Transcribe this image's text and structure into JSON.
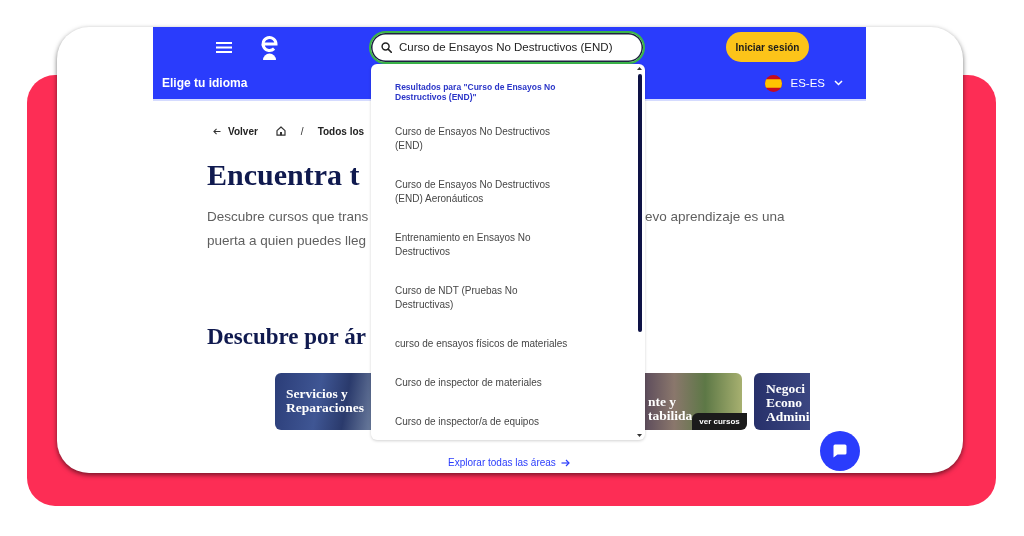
{
  "header": {
    "search": {
      "value": "Curso de Ensayos No Destructivos (END)"
    },
    "login_button": "Iniciar sesión"
  },
  "language_bar": {
    "label": "Elige tu idioma",
    "locale": "ES-ES"
  },
  "search_dropdown": {
    "heading": "Resultados para \"Curso de Ensayos No Destructivos (END)\"",
    "suggestions": [
      "Curso de Ensayos No Destructivos (END)",
      "Curso de Ensayos No Destructivos (END) Aeronáuticos",
      "Entrenamiento en Ensayos No Destructivos",
      "Curso de NDT (Pruebas No Destructivas)",
      "curso de ensayos físicos de materiales",
      "Curso de inspector de materiales",
      "Curso de inspector/a de equipos"
    ]
  },
  "breadcrumb": {
    "back": "Volver",
    "separator": "/",
    "current": "Todos los"
  },
  "hero": {
    "title": "Encuentra t",
    "description_left": "Descubre cursos que trans\npuerta a quien puedes lleg",
    "description_right": "evo aprendizaje es una"
  },
  "areas": {
    "title": "Descubre por ár",
    "cards": [
      {
        "title": "Servicios y Reparaciones"
      },
      {
        "title": "nte y\ntabilida",
        "button": "ver cursos"
      },
      {
        "title": "Negoci\nEcono\nAdmini"
      }
    ],
    "explore_link": "Explorar todas las áreas"
  }
}
